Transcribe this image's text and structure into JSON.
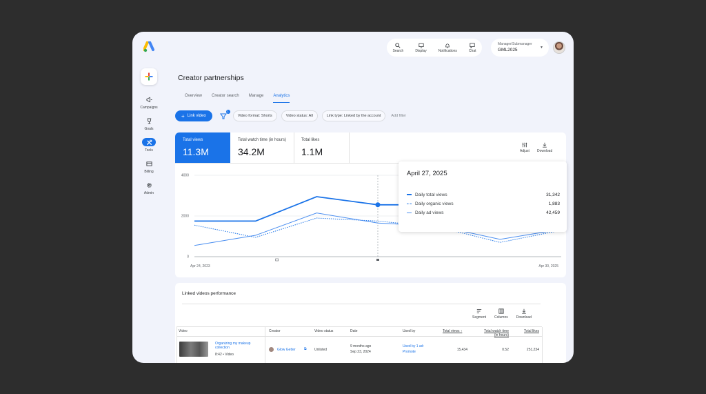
{
  "topnav": {
    "items": [
      {
        "label": "Search",
        "icon": "search-icon"
      },
      {
        "label": "Display",
        "icon": "monitor-icon"
      },
      {
        "label": "Notifications",
        "icon": "bell-icon"
      },
      {
        "label": "Chat",
        "icon": "chat-icon"
      }
    ]
  },
  "account": {
    "role": "Manager/Submanager",
    "name": "GML2025"
  },
  "sidebar": {
    "items": [
      {
        "label": "Campaigns",
        "icon": "megaphone-icon"
      },
      {
        "label": "Goals",
        "icon": "trophy-icon"
      },
      {
        "label": "Tools",
        "icon": "tools-icon",
        "active": true
      },
      {
        "label": "Billing",
        "icon": "credit-card-icon"
      },
      {
        "label": "Admin",
        "icon": "gear-icon"
      }
    ]
  },
  "page": {
    "title": "Creator partnerships"
  },
  "tabs": [
    "Overview",
    "Creator search",
    "Manage",
    "Analytics"
  ],
  "active_tab": "Analytics",
  "filters": {
    "link_button": "Link video",
    "filter_badge": "1",
    "chips": [
      "Video format: Shorts",
      "Video status: All",
      "Link type: Linked by the account"
    ],
    "add_filter": "Add filter"
  },
  "metrics": [
    {
      "label": "Total views",
      "value": "11.3M"
    },
    {
      "label": "Total watch time (in hours)",
      "value": "34.2M"
    },
    {
      "label": "Total likes",
      "value": "1.1M"
    }
  ],
  "chart_tools": {
    "adjust": "Adjust",
    "download": "Download"
  },
  "chart_data": {
    "type": "line",
    "x": [
      "Apr 24, 2025",
      "",
      "",
      "Apr 27, 2025",
      "",
      "",
      "Apr 30, 2025"
    ],
    "x_start_label": "Apr 24, 2023",
    "x_end_label": "Apr 30, 2025",
    "yticks": [
      "4000",
      "2000",
      "0"
    ],
    "ylim": [
      0,
      4000
    ],
    "series": [
      {
        "name": "Daily total views",
        "style": "solid-thick",
        "color": "#1a73e8",
        "values": [
          1750,
          1750,
          2950,
          2550,
          2550,
          1750,
          2750
        ]
      },
      {
        "name": "Daily organic views",
        "style": "dotted",
        "color": "#1a73e8",
        "values": [
          1550,
          950,
          1900,
          1750,
          1450,
          700,
          1300
        ]
      },
      {
        "name": "Daily ad views",
        "style": "solid-thin",
        "color": "#4a8ef0",
        "values": [
          550,
          1050,
          2150,
          1650,
          1500,
          850,
          1350
        ]
      }
    ],
    "grid": true,
    "marker_index": 3
  },
  "tooltip": {
    "date": "April 27, 2025",
    "rows": [
      {
        "label": "Daily total views",
        "value": "31,342"
      },
      {
        "label": "Daily organic views",
        "value": "1,883"
      },
      {
        "label": "Daily ad views",
        "value": "42,459"
      }
    ]
  },
  "table": {
    "title": "Linked videos performance",
    "tools": [
      "Segment",
      "Columns",
      "Download"
    ],
    "columns": [
      "Video",
      "Creator",
      "Video status",
      "Date",
      "Used by",
      "Total views",
      "Total watch time (in hours)",
      "Total likes"
    ],
    "rows": [
      {
        "video_title": "Organizing my makeup collection",
        "video_meta": "8:42 • Video",
        "creator": "Glow Getter",
        "status": "Unlisted",
        "date_rel": "9 months ago",
        "date": "Sep 23, 2024",
        "used_by": "Used by 1 ad:",
        "used_by_link": "Promote",
        "views": "15,434",
        "watch_time": "0.52",
        "likes": "251,234"
      }
    ]
  }
}
